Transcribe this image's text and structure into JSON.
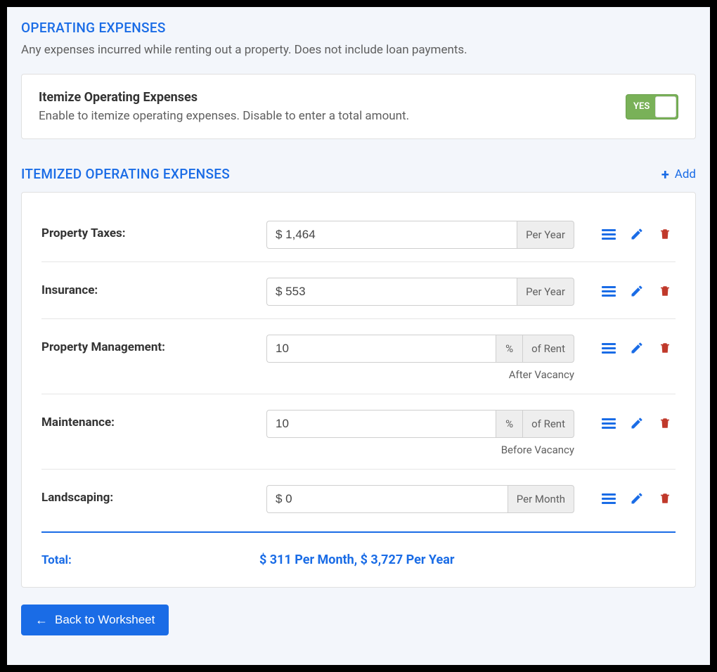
{
  "section1": {
    "title": "OPERATING EXPENSES",
    "description": "Any expenses incurred while renting out a property. Does not include loan payments."
  },
  "itemize": {
    "title": "Itemize Operating Expenses",
    "description": "Enable to itemize operating expenses. Disable to enter a total amount.",
    "toggle_label": "YES"
  },
  "section2": {
    "title": "ITEMIZED OPERATING EXPENSES",
    "add_label": "Add"
  },
  "expenses": [
    {
      "label": "Property Taxes:",
      "value": "$ 1,464",
      "unit": "Per Year",
      "subtext": ""
    },
    {
      "label": "Insurance:",
      "value": "$ 553",
      "unit": "Per Year",
      "subtext": ""
    },
    {
      "label": "Property Management:",
      "value": "10",
      "unit_pct": "%",
      "unit_of": "of Rent",
      "subtext": "After Vacancy"
    },
    {
      "label": "Maintenance:",
      "value": "10",
      "unit_pct": "%",
      "unit_of": "of Rent",
      "subtext": "Before Vacancy"
    },
    {
      "label": "Landscaping:",
      "value": "$ 0",
      "unit": "Per Month",
      "subtext": ""
    }
  ],
  "totals": {
    "label": "Total:",
    "text": "$ 311 Per Month,   $ 3,727 Per Year"
  },
  "back_button": "Back to Worksheet",
  "colors": {
    "primary": "#1a6ce6",
    "toggle_green": "#79b158",
    "delete_red": "#c0392b"
  }
}
